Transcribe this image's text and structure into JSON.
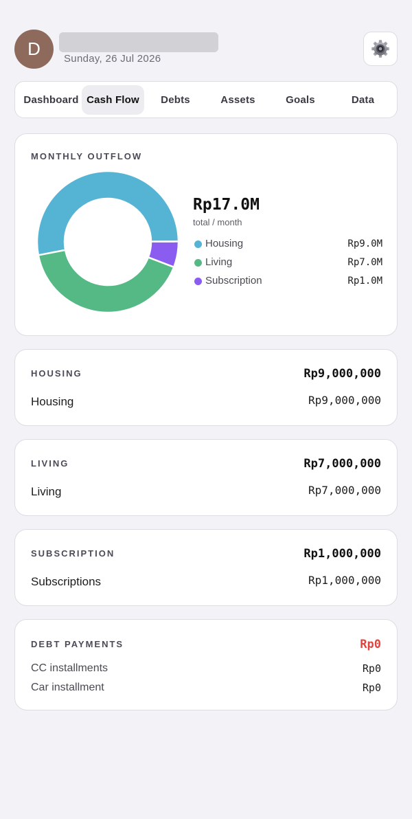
{
  "header": {
    "avatar_initial": "D",
    "date": "Sunday, 26 Jul 2026"
  },
  "tabs": [
    {
      "label": "Dashboard",
      "active": false
    },
    {
      "label": "Cash Flow",
      "active": true
    },
    {
      "label": "Debts",
      "active": false
    },
    {
      "label": "Assets",
      "active": false
    },
    {
      "label": "Goals",
      "active": false
    },
    {
      "label": "Data",
      "active": false
    }
  ],
  "outflow": {
    "title": "MONTHLY OUTFLOW",
    "total": "Rp17.0M",
    "total_sub": "total / month",
    "legend": [
      {
        "name": "Housing",
        "amount": "Rp9.0M"
      },
      {
        "name": "Living",
        "amount": "Rp7.0M"
      },
      {
        "name": "Subscription",
        "amount": "Rp1.0M"
      }
    ]
  },
  "chart_data": {
    "type": "pie",
    "categories": [
      "Housing",
      "Living",
      "Subscription"
    ],
    "values": [
      9000000,
      7000000,
      1000000
    ],
    "colors": [
      "#55b3d4",
      "#55b985",
      "#8a5cf0"
    ],
    "legend": "right"
  },
  "sections": {
    "housing": {
      "title": "HOUSING",
      "total": "Rp9,000,000",
      "rows": [
        {
          "label": "Housing",
          "value": "Rp9,000,000"
        }
      ]
    },
    "living": {
      "title": "LIVING",
      "total": "Rp7,000,000",
      "rows": [
        {
          "label": "Living",
          "value": "Rp7,000,000"
        }
      ]
    },
    "subscription": {
      "title": "SUBSCRIPTION",
      "total": "Rp1,000,000",
      "rows": [
        {
          "label": "Subscriptions",
          "value": "Rp1,000,000"
        }
      ]
    },
    "debt": {
      "title": "DEBT PAYMENTS",
      "total": "Rp0",
      "total_color": "#e0443e",
      "rows": [
        {
          "label": "CC installments",
          "value": "Rp0"
        },
        {
          "label": "Car installment",
          "value": "Rp0"
        }
      ]
    }
  },
  "icons": {
    "settings": "gear-icon"
  }
}
